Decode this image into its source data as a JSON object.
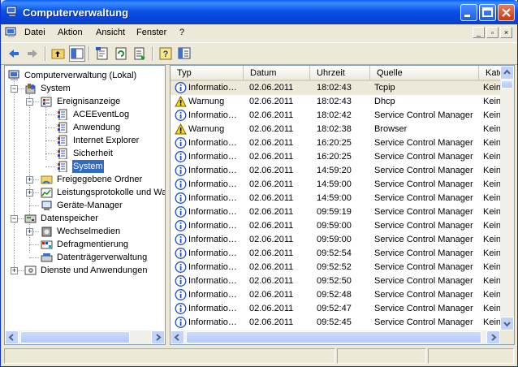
{
  "window": {
    "title": "Computerverwaltung"
  },
  "menu": {
    "items": [
      "Datei",
      "Aktion",
      "Ansicht",
      "Fenster",
      "?"
    ]
  },
  "toolbar": {
    "icons": [
      "back-icon",
      "forward-icon",
      "up-folder-icon",
      "show-tree-icon",
      "properties-icon",
      "refresh-icon",
      "export-list-icon",
      "help-icon",
      "console-tree-icon"
    ]
  },
  "tree": {
    "items": [
      {
        "label": "Computerverwaltung (Lokal)",
        "icon": "computer-icon"
      },
      {
        "label": "System",
        "icon": "tools-icon"
      },
      {
        "label": "Ereignisanzeige",
        "icon": "event-viewer-icon"
      },
      {
        "label": "ACEEventLog",
        "icon": "log-icon"
      },
      {
        "label": "Anwendung",
        "icon": "log-icon"
      },
      {
        "label": "Internet Explorer",
        "icon": "log-icon"
      },
      {
        "label": "Sicherheit",
        "icon": "log-icon"
      },
      {
        "label": "System",
        "icon": "log-icon"
      },
      {
        "label": "Freigegebene Ordner",
        "icon": "shared-folder-icon"
      },
      {
        "label": "Leistungsprotokolle und Warnungen",
        "icon": "performance-icon"
      },
      {
        "label": "Geräte-Manager",
        "icon": "device-manager-icon"
      },
      {
        "label": "Datenspeicher",
        "icon": "storage-icon"
      },
      {
        "label": "Wechselmedien",
        "icon": "removable-media-icon"
      },
      {
        "label": "Defragmentierung",
        "icon": "defrag-icon"
      },
      {
        "label": "Datenträgerverwaltung",
        "icon": "disk-management-icon"
      },
      {
        "label": "Dienste und Anwendungen",
        "icon": "services-icon"
      }
    ]
  },
  "list": {
    "columns": [
      "Typ",
      "Datum",
      "Uhrzeit",
      "Quelle",
      "Kategorie"
    ],
    "rows": [
      {
        "type": "Informationen",
        "kind": "info",
        "date": "02.06.2011",
        "time": "18:02:43",
        "source": "Tcpip",
        "category": "Keine"
      },
      {
        "type": "Warnung",
        "kind": "warn",
        "date": "02.06.2011",
        "time": "18:02:43",
        "source": "Dhcp",
        "category": "Keine"
      },
      {
        "type": "Informationen",
        "kind": "info",
        "date": "02.06.2011",
        "time": "18:02:42",
        "source": "Service Control Manager",
        "category": "Keine"
      },
      {
        "type": "Warnung",
        "kind": "warn",
        "date": "02.06.2011",
        "time": "18:02:38",
        "source": "Browser",
        "category": "Keine"
      },
      {
        "type": "Informationen",
        "kind": "info",
        "date": "02.06.2011",
        "time": "16:20:25",
        "source": "Service Control Manager",
        "category": "Keine"
      },
      {
        "type": "Informationen",
        "kind": "info",
        "date": "02.06.2011",
        "time": "16:20:25",
        "source": "Service Control Manager",
        "category": "Keine"
      },
      {
        "type": "Informationen",
        "kind": "info",
        "date": "02.06.2011",
        "time": "14:59:20",
        "source": "Service Control Manager",
        "category": "Keine"
      },
      {
        "type": "Informationen",
        "kind": "info",
        "date": "02.06.2011",
        "time": "14:59:00",
        "source": "Service Control Manager",
        "category": "Keine"
      },
      {
        "type": "Informationen",
        "kind": "info",
        "date": "02.06.2011",
        "time": "14:59:00",
        "source": "Service Control Manager",
        "category": "Keine"
      },
      {
        "type": "Informationen",
        "kind": "info",
        "date": "02.06.2011",
        "time": "09:59:19",
        "source": "Service Control Manager",
        "category": "Keine"
      },
      {
        "type": "Informationen",
        "kind": "info",
        "date": "02.06.2011",
        "time": "09:59:00",
        "source": "Service Control Manager",
        "category": "Keine"
      },
      {
        "type": "Informationen",
        "kind": "info",
        "date": "02.06.2011",
        "time": "09:59:00",
        "source": "Service Control Manager",
        "category": "Keine"
      },
      {
        "type": "Informationen",
        "kind": "info",
        "date": "02.06.2011",
        "time": "09:52:54",
        "source": "Service Control Manager",
        "category": "Keine"
      },
      {
        "type": "Informationen",
        "kind": "info",
        "date": "02.06.2011",
        "time": "09:52:52",
        "source": "Service Control Manager",
        "category": "Keine"
      },
      {
        "type": "Informationen",
        "kind": "info",
        "date": "02.06.2011",
        "time": "09:52:50",
        "source": "Service Control Manager",
        "category": "Keine"
      },
      {
        "type": "Informationen",
        "kind": "info",
        "date": "02.06.2011",
        "time": "09:52:48",
        "source": "Service Control Manager",
        "category": "Keine"
      },
      {
        "type": "Informationen",
        "kind": "info",
        "date": "02.06.2011",
        "time": "09:52:47",
        "source": "Service Control Manager",
        "category": "Keine"
      },
      {
        "type": "Informationen",
        "kind": "info",
        "date": "02.06.2011",
        "time": "09:52:45",
        "source": "Service Control Manager",
        "category": "Keine"
      }
    ]
  },
  "colors": {
    "title_blue": "#0a52e8",
    "selection": "#316ac5",
    "info_blue": "#1c4fc9",
    "warn_yellow": "#f8d81c"
  }
}
